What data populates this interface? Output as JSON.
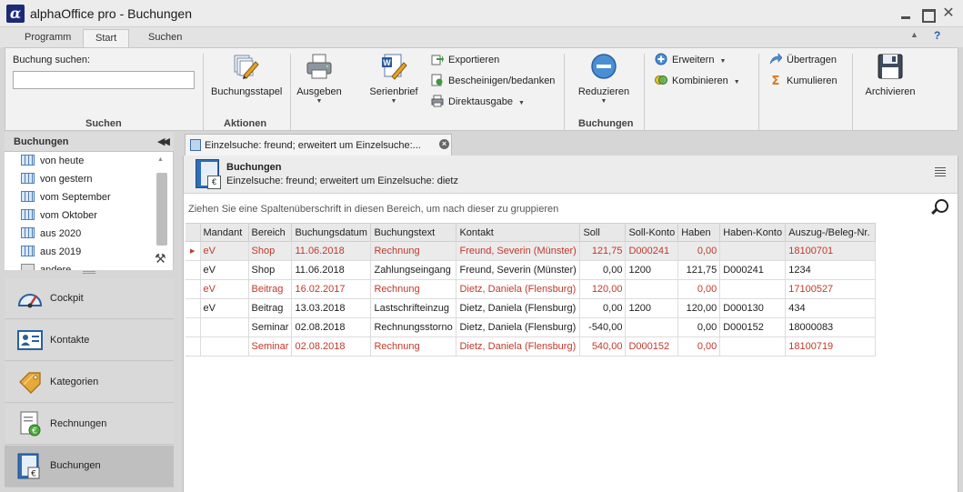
{
  "window": {
    "title": "alphaOffice pro - Buchungen",
    "logo": "α"
  },
  "ribbon_tabs": [
    "Programm",
    "Start",
    "Suchen"
  ],
  "ribbon": {
    "search_label": "Buchung suchen:",
    "search_value": "",
    "groups": {
      "suchen": "Suchen",
      "aktionen": "Aktionen",
      "buchungen": "Buchungen"
    },
    "buttons": {
      "buchungsstapel": "Buchungsstapel",
      "ausgeben": "Ausgeben",
      "serienbrief": "Serienbrief",
      "exportieren": "Exportieren",
      "bescheinigen": "Bescheinigen/bedanken",
      "direktausgabe": "Direktausgabe",
      "reduzieren": "Reduzieren",
      "erweitern": "Erweitern",
      "kombinieren": "Kombinieren",
      "uebertragen": "Übertragen",
      "kumulieren": "Kumulieren",
      "archivieren": "Archivieren"
    }
  },
  "left_panel": {
    "title": "Buchungen",
    "items": [
      "von heute",
      "von gestern",
      "vom September",
      "vom Oktober",
      "aus 2020",
      "aus 2019",
      "andere"
    ]
  },
  "nav": [
    {
      "label": "Cockpit",
      "icon": "gauge-icon"
    },
    {
      "label": "Kontakte",
      "icon": "contact-card-icon"
    },
    {
      "label": "Kategorien",
      "icon": "tag-icon"
    },
    {
      "label": "Rechnungen",
      "icon": "invoice-icon"
    },
    {
      "label": "Buchungen",
      "icon": "ledger-icon"
    }
  ],
  "doc_tab": {
    "label": "Einzelsuche: freund; erweitert um Einzelsuche:..."
  },
  "main": {
    "title": "Buchungen",
    "subtitle": "Einzelsuche: freund; erweitert um Einzelsuche: dietz",
    "group_hint": "Ziehen Sie eine Spaltenüberschrift in diesen Bereich, um nach dieser zu gruppieren"
  },
  "table": {
    "columns": [
      "Mandant",
      "Bereich",
      "Buchungsdatum",
      "Buchungstext",
      "Kontakt",
      "Soll",
      "Soll-Konto",
      "Haben",
      "Haben-Konto",
      "Auszug-/Beleg-Nr."
    ],
    "rows": [
      [
        "eV",
        "Shop",
        "11.06.2018",
        "Rechnung",
        "Freund, Severin (Münster)",
        "121,75",
        "D000241",
        "0,00",
        "",
        "18100701"
      ],
      [
        "eV",
        "Shop",
        "11.06.2018",
        "Zahlungseingang",
        "Freund, Severin (Münster)",
        "0,00",
        "1200",
        "121,75",
        "D000241",
        "1234"
      ],
      [
        "eV",
        "Beitrag",
        "16.02.2017",
        "Rechnung",
        "Dietz, Daniela (Flensburg)",
        "120,00",
        "",
        "0,00",
        "",
        "17100527"
      ],
      [
        "eV",
        "Beitrag",
        "13.03.2018",
        "Lastschrifteinzug",
        "Dietz, Daniela (Flensburg)",
        "0,00",
        "1200",
        "120,00",
        "D000130",
        "434"
      ],
      [
        "",
        "Seminar",
        "02.08.2018",
        "Rechnungsstorno",
        "Dietz, Daniela (Flensburg)",
        "-540,00",
        "",
        "0,00",
        "D000152",
        "18000083"
      ],
      [
        "",
        "Seminar",
        "02.08.2018",
        "Rechnung",
        "Dietz, Daniela (Flensburg)",
        "540,00",
        "D000152",
        "0,00",
        "",
        "18100719"
      ]
    ],
    "red_rows": [
      0,
      2,
      5
    ],
    "selected_row": 0
  },
  "colors": {
    "accent_red": "#c0392b",
    "logo_blue": "#1b2a78",
    "icon_blue": "#2f6db6"
  }
}
